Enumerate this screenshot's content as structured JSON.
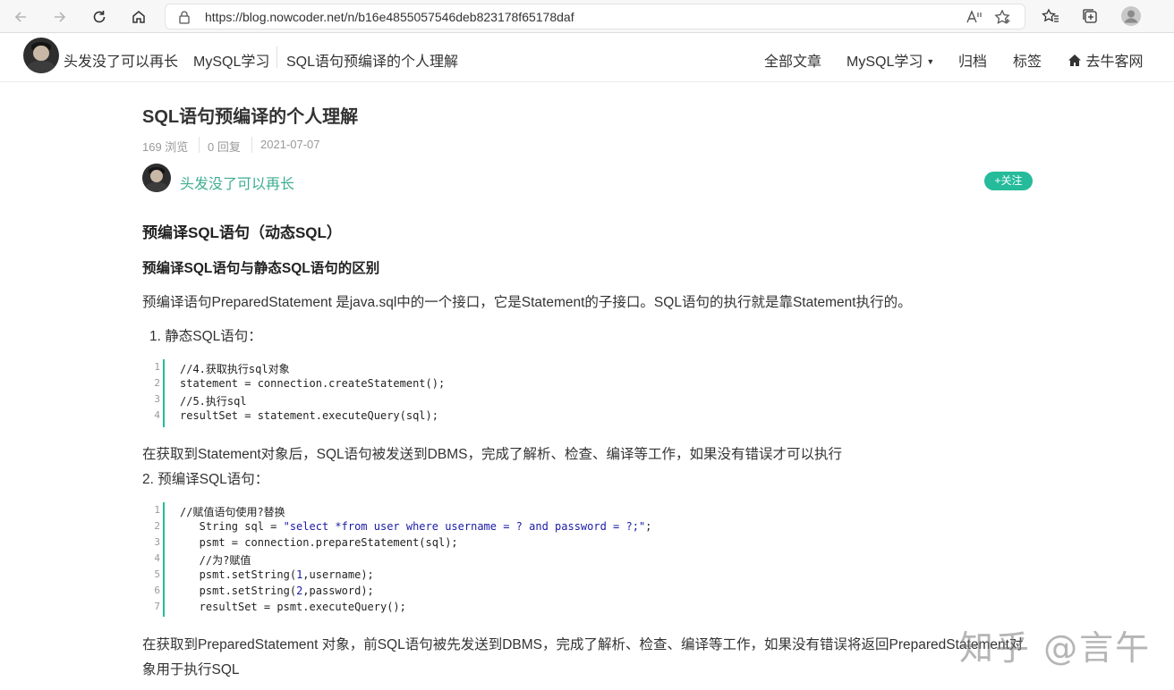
{
  "browser": {
    "url": "https://blog.nowcoder.net/n/b16e4855057546deb823178f65178daf",
    "read_aloud": "Aᵃ"
  },
  "header": {
    "author": "头发没了可以再长",
    "column": "MySQL学习",
    "article": "SQL语句预编译的个人理解",
    "nav": [
      "全部文章",
      "MySQL学习",
      "归档",
      "标签",
      "去牛客网"
    ]
  },
  "article": {
    "title": "SQL语句预编译的个人理解",
    "views": "169 浏览",
    "replies": "0 回复",
    "date": "2021-07-07",
    "author": "头发没了可以再长",
    "follow": "+关注",
    "h2": "预编译SQL语句（动态SQL）",
    "h3": "预编译SQL语句与静态SQL语句的区别",
    "intro": "预编译语句PreparedStatement 是java.sql中的一个接口，它是Statement的子接口。SQL语句的执行就是靠Statement执行的。",
    "item1": "1. 静态SQL语句：",
    "code1": [
      {
        "n": "1",
        "text": "//4.获取执行sql对象",
        "kind": "comment"
      },
      {
        "n": "2",
        "text": "statement = connection.createStatement();",
        "kind": "plain"
      },
      {
        "n": "3",
        "text": "//5.执行sql",
        "kind": "comment"
      },
      {
        "n": "4",
        "text": "resultSet = statement.executeQuery(sql);",
        "kind": "plain"
      }
    ],
    "after1": "在获取到Statement对象后，SQL语句被发送到DBMS，完成了解析、检查、编译等工作，如果没有错误才可以执行",
    "item2": "2. 预编译SQL语句：",
    "code2": [
      {
        "n": "1",
        "text": "//赋值语句使用?替换",
        "kind": "comment",
        "indent": ""
      },
      {
        "n": "2",
        "text": "   String sql = \"select *from user where username = ? and password = ?;\";",
        "kind": "string",
        "indent": ""
      },
      {
        "n": "3",
        "text": "   psmt = connection.prepareStatement(sql);",
        "kind": "plain",
        "indent": ""
      },
      {
        "n": "4",
        "text": "   //为?赋值",
        "kind": "comment",
        "indent": ""
      },
      {
        "n": "5",
        "text": "   psmt.setString(1,username);",
        "kind": "plain",
        "indent": ""
      },
      {
        "n": "6",
        "text": "   psmt.setString(2,password);",
        "kind": "plain",
        "indent": ""
      },
      {
        "n": "7",
        "text": "   resultSet = psmt.executeQuery();",
        "kind": "plain",
        "indent": ""
      }
    ],
    "after2_line1": "在获取到PreparedStatement 对象，前SQL语句被先发送到DBMS，完成了解析、检查、编译等工作，如果没有错误将返回PreparedStatement对",
    "after2_line2": "象用于执行SQL"
  },
  "watermark": "知乎 @言午",
  "colors": {
    "accent": "#25bb9b",
    "author_link": "#3fae92",
    "comment": "#13a89e"
  }
}
